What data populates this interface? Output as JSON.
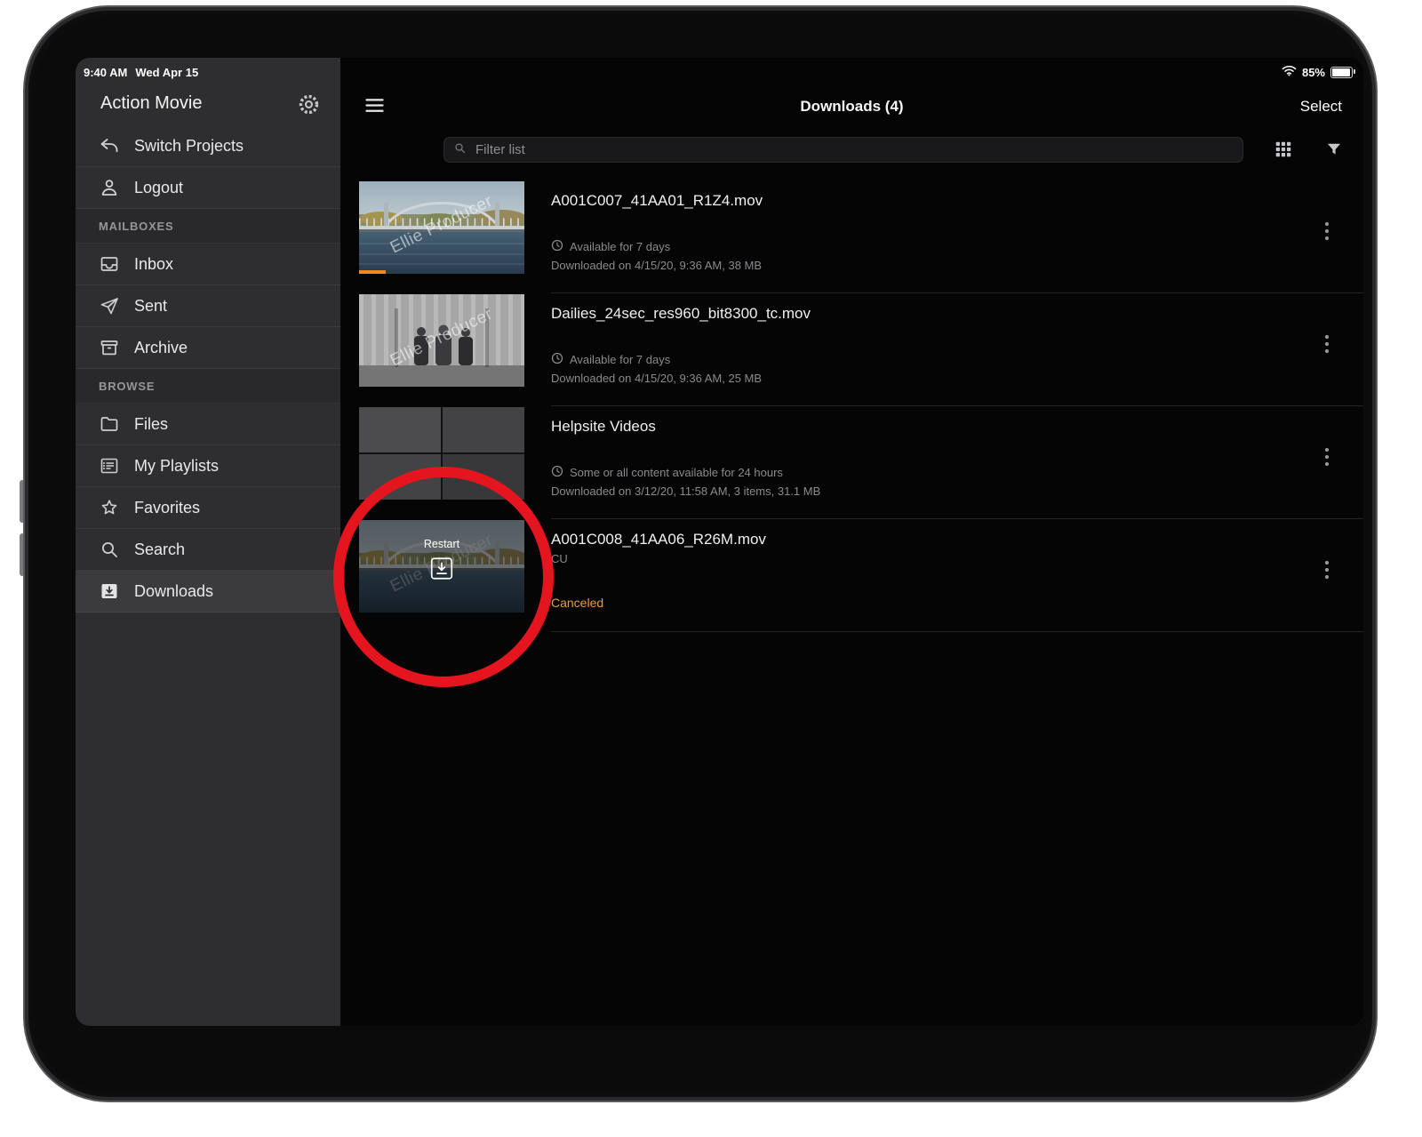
{
  "status_bar": {
    "time": "9:40 AM",
    "date": "Wed Apr 15",
    "battery_percent": "85%"
  },
  "sidebar": {
    "title": "Action Movie",
    "top_items": [
      {
        "label": "Switch Projects",
        "icon": "switch-projects-icon"
      },
      {
        "label": "Logout",
        "icon": "person-icon"
      }
    ],
    "mailboxes_header": "MAILBOXES",
    "mailboxes": [
      {
        "label": "Inbox",
        "icon": "inbox-icon"
      },
      {
        "label": "Sent",
        "icon": "paper-plane-icon"
      },
      {
        "label": "Archive",
        "icon": "archive-icon"
      }
    ],
    "browse_header": "BROWSE",
    "browse": [
      {
        "label": "Files",
        "icon": "folder-icon"
      },
      {
        "label": "My Playlists",
        "icon": "playlist-icon"
      },
      {
        "label": "Favorites",
        "icon": "star-icon"
      },
      {
        "label": "Search",
        "icon": "search-icon"
      },
      {
        "label": "Downloads",
        "icon": "download-icon",
        "selected": true
      }
    ]
  },
  "main": {
    "title": "Downloads (4)",
    "select_label": "Select",
    "filter_placeholder": "Filter list"
  },
  "downloads": [
    {
      "title": "A001C007_41AA01_R1Z4.mov",
      "availability": "Available for 7 days",
      "details": "Downloaded on 4/15/20, 9:36 AM, 38 MB",
      "watermark": "Ellie Producer"
    },
    {
      "title": "Dailies_24sec_res960_bit8300_tc.mov",
      "availability": "Available for 7 days",
      "details": "Downloaded on 4/15/20, 9:36 AM, 25 MB",
      "watermark": "Ellie Producer"
    },
    {
      "title": "Helpsite Videos",
      "availability": "Some or all content available for 24 hours",
      "details": "Downloaded on 3/12/20, 11:58 AM, 3 items, 31.1 MB"
    },
    {
      "title": "A001C008_41AA06_R26M.mov",
      "subtitle": "CU",
      "status": "Canceled",
      "overlay_label": "Restart",
      "watermark": "Ellie Producer"
    }
  ],
  "colors": {
    "canceled_orange": "#ec9a3c",
    "progress_orange": "#f08a1e",
    "annotation_red": "#e4151e"
  }
}
